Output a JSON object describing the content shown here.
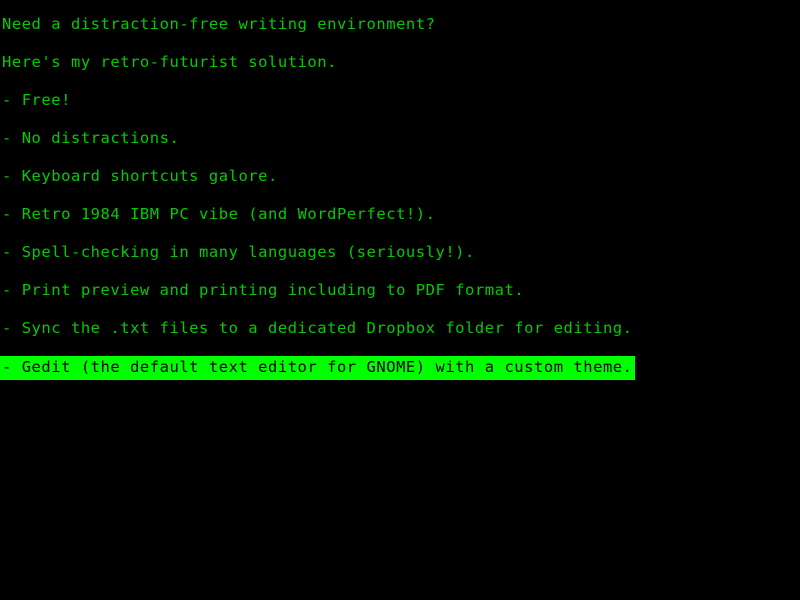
{
  "editor": {
    "theme_name": "retro-green-on-black",
    "colors": {
      "background": "#000000",
      "text": "#00cc00",
      "highlight_background": "#00ff00",
      "highlight_text": "#000000"
    }
  },
  "document": {
    "lines": [
      {
        "text": "Need a distraction-free writing environment?",
        "highlighted": false
      },
      {
        "text": "Here's my retro-futurist solution.",
        "highlighted": false
      },
      {
        "text": "- Free!",
        "highlighted": false
      },
      {
        "text": "- No distractions.",
        "highlighted": false
      },
      {
        "text": "- Keyboard shortcuts galore.",
        "highlighted": false
      },
      {
        "text": "- Retro 1984 IBM PC vibe (and WordPerfect!).",
        "highlighted": false
      },
      {
        "text": "- Spell-checking in many languages (seriously!).",
        "highlighted": false
      },
      {
        "text": "- Print preview and printing including to PDF format.",
        "highlighted": false
      },
      {
        "text": "- Sync the .txt files to a dedicated Dropbox folder for editing.",
        "highlighted": false
      },
      {
        "text": "- Gedit (the default text editor for GNOME) with a custom theme.",
        "highlighted": true
      }
    ]
  }
}
